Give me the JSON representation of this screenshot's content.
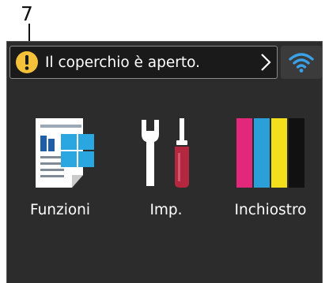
{
  "callout": {
    "number": "7"
  },
  "status": {
    "icon": "warning-icon",
    "message": "Il coperchio è aperto.",
    "chevron": "chevron-right-icon"
  },
  "wifi": {
    "icon": "wifi-icon",
    "color": "#3aa0e8"
  },
  "tiles": [
    {
      "label": "Funzioni",
      "icon": "functions-icon"
    },
    {
      "label": "Imp.",
      "icon": "settings-tools-icon"
    },
    {
      "label": "Inchiostro",
      "icon": "ink-cartridges-icon"
    }
  ],
  "colors": {
    "screen_bg": "#2c2c2c",
    "warning": "#f3c13a",
    "magenta": "#e2287a",
    "cyan": "#2a9fd8",
    "yellow": "#f4df1c",
    "black": "#111111",
    "tool_red": "#b3283e"
  }
}
